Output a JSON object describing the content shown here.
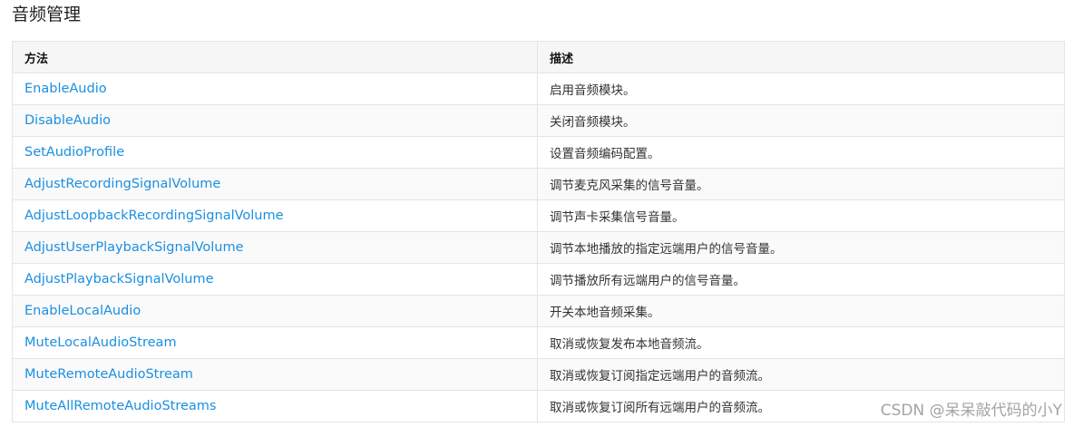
{
  "section": {
    "title": "音频管理"
  },
  "table": {
    "headers": [
      "方法",
      "描述"
    ],
    "rows": [
      {
        "method": "EnableAudio",
        "desc": "启用音频模块。"
      },
      {
        "method": "DisableAudio",
        "desc": "关闭音频模块。"
      },
      {
        "method": "SetAudioProfile",
        "desc": "设置音频编码配置。"
      },
      {
        "method": "AdjustRecordingSignalVolume",
        "desc": "调节麦克风采集的信号音量。"
      },
      {
        "method": "AdjustLoopbackRecordingSignalVolume",
        "desc": "调节声卡采集信号音量。"
      },
      {
        "method": "AdjustUserPlaybackSignalVolume",
        "desc": "调节本地播放的指定远端用户的信号音量。"
      },
      {
        "method": "AdjustPlaybackSignalVolume",
        "desc": "调节播放所有远端用户的信号音量。"
      },
      {
        "method": "EnableLocalAudio",
        "desc": "开关本地音频采集。"
      },
      {
        "method": "MuteLocalAudioStream",
        "desc": "取消或恢复发布本地音频流。"
      },
      {
        "method": "MuteRemoteAudioStream",
        "desc": "取消或恢复订阅指定远端用户的音频流。"
      },
      {
        "method": "MuteAllRemoteAudioStreams",
        "desc": "取消或恢复订阅所有远端用户的音频流。"
      }
    ]
  },
  "watermark": "CSDN @呆呆敲代码的小Y",
  "colors": {
    "link": "#1b8fe0",
    "header_bg": "#f6f6f6",
    "border": "#e4e4e4"
  }
}
